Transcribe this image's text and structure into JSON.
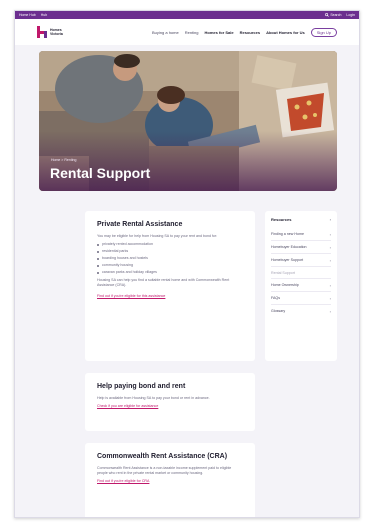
{
  "utility": {
    "left_links": [
      "Home Hub",
      "Hub"
    ],
    "search_label": "Search",
    "login_label": "Login"
  },
  "header": {
    "logo_text": "Homes Victoria",
    "nav": [
      "Buying a home",
      "Renting",
      "Homes for Sale",
      "Resources",
      "About Homes for Us"
    ],
    "signup_label": "Sign Up"
  },
  "hero": {
    "breadcrumb": "Home > Renting",
    "title": "Rental Support"
  },
  "cards": [
    {
      "title": "Private Rental Assistance",
      "intro": "You may be eligible for help from Housing SA to pay your rent and bond for:",
      "items": [
        "privately rented accommodation",
        "residential parks",
        "boarding houses and hostels",
        "community housing",
        "caravan parks and holiday villages"
      ],
      "note": "Housing SA can help you find a suitable rental home and with Commonwealth Rent Assistance (CRA).",
      "link": "Find out if you're eligible for this assistance"
    },
    {
      "title": "Help paying bond and rent",
      "intro": "Help is available from Housing SA to pay your bond or rent in advance.",
      "link": "Check if you are eligible for assistance"
    },
    {
      "title": "Commonwealth Rent Assistance (CRA)",
      "intro": "Commonwealth Rent Assistance is a non-taxable income supplement paid to eligible people who rent in the private rental market or community housing.",
      "link": "Find out if you're eligible for CRA"
    }
  ],
  "sidebar": {
    "title": "Resources",
    "items": [
      {
        "label": "Finding a new Home",
        "active": false
      },
      {
        "label": "Homebuyer Education",
        "active": false
      },
      {
        "label": "Homebuyer Support",
        "active": false
      },
      {
        "label": "Rental Support",
        "active": true
      },
      {
        "label": "Home Ownership",
        "active": false
      },
      {
        "label": "FAQs",
        "active": false
      },
      {
        "label": "Glossary",
        "active": false
      }
    ]
  },
  "colors": {
    "brand_purple": "#6b2e8f",
    "accent_pink": "#c0186b",
    "page_bg": "#f4f3f8"
  }
}
